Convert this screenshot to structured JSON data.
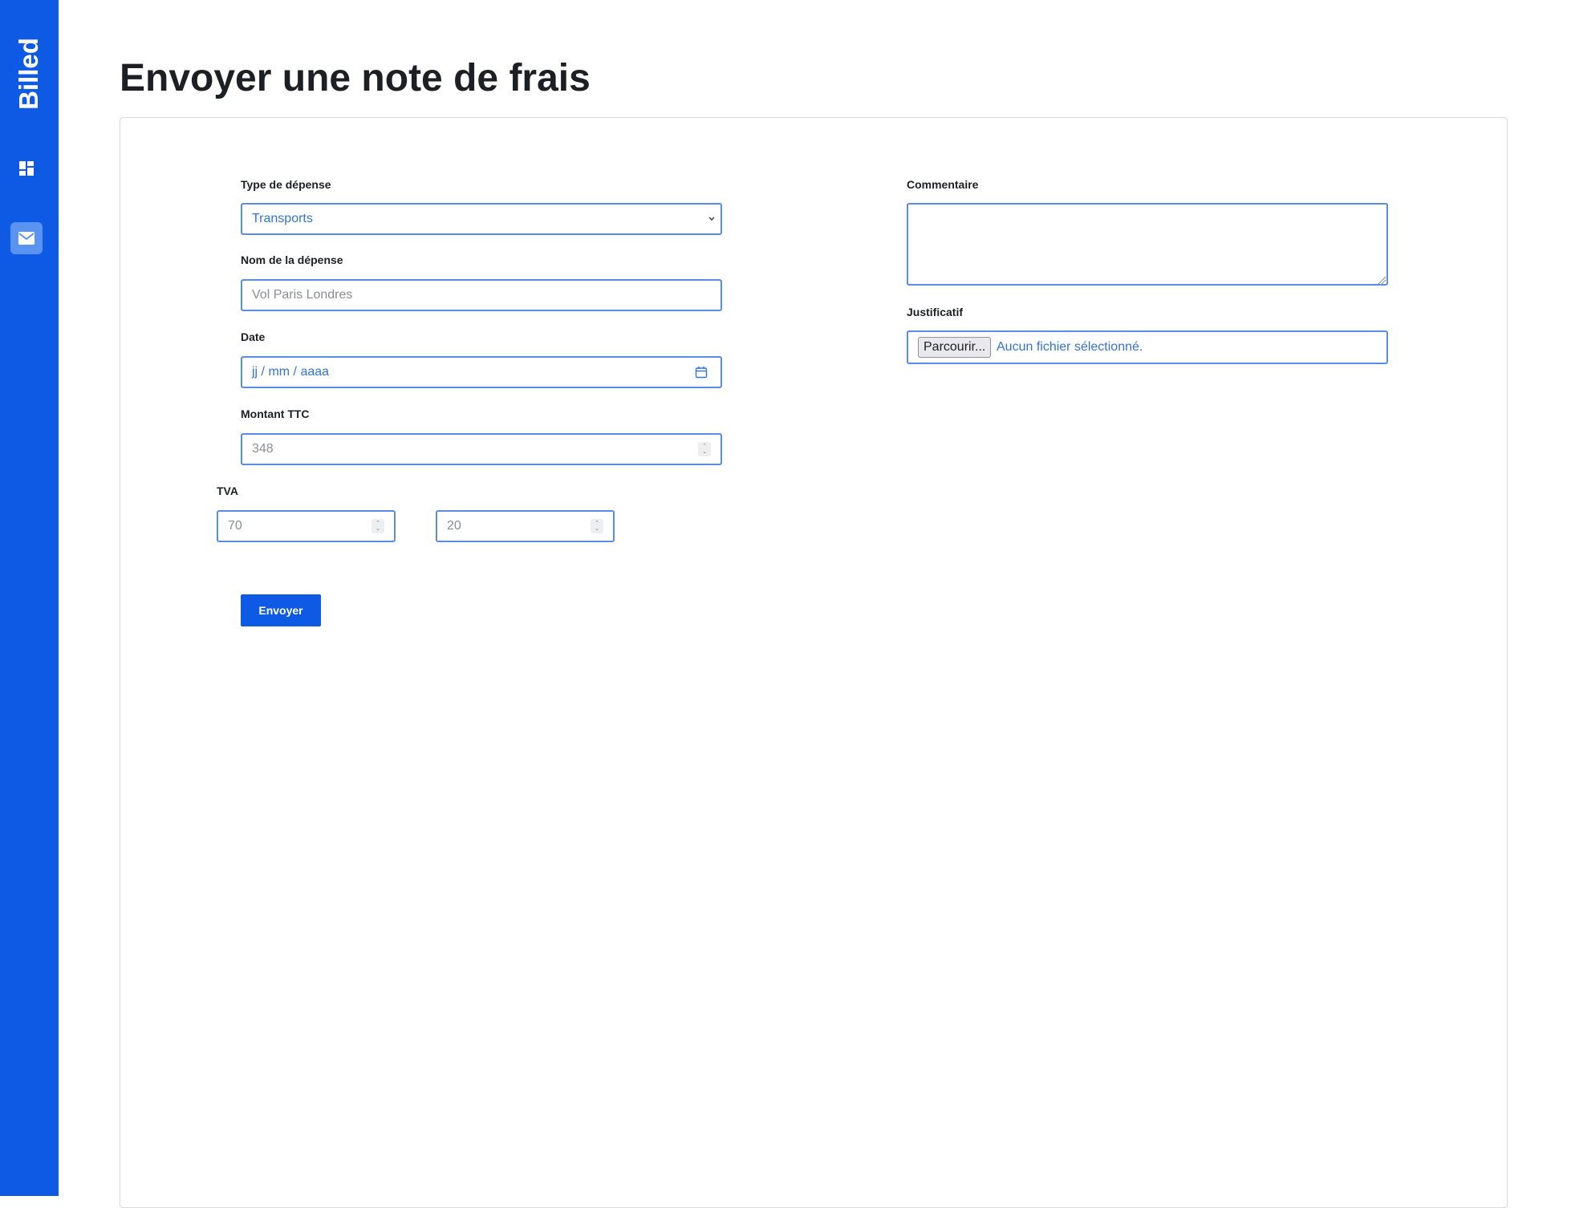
{
  "brand": "Billed",
  "page": {
    "title": "Envoyer une note de frais"
  },
  "form": {
    "type": {
      "label": "Type de dépense",
      "value": "Transports"
    },
    "name": {
      "label": "Nom de la dépense",
      "placeholder": "Vol Paris Londres"
    },
    "date": {
      "label": "Date",
      "placeholder": "jj / mm / aaaa"
    },
    "amount": {
      "label": "Montant TTC",
      "placeholder": "348"
    },
    "vat": {
      "label": "TVA",
      "amount_placeholder": "70",
      "percent_placeholder": "20"
    },
    "comment": {
      "label": "Commentaire",
      "value": ""
    },
    "file": {
      "label": "Justificatif",
      "button": "Parcourir...",
      "status": "Aucun fichier sélectionné."
    },
    "submit": "Envoyer"
  },
  "colors": {
    "accent": "#0e5ae5",
    "field_border": "#5a8ce6",
    "link_text": "#3273dc"
  },
  "icons": {
    "nav_1": "windows-icon",
    "nav_2": "mail-icon",
    "date": "calendar-icon",
    "select": "chevron-down-icon"
  }
}
